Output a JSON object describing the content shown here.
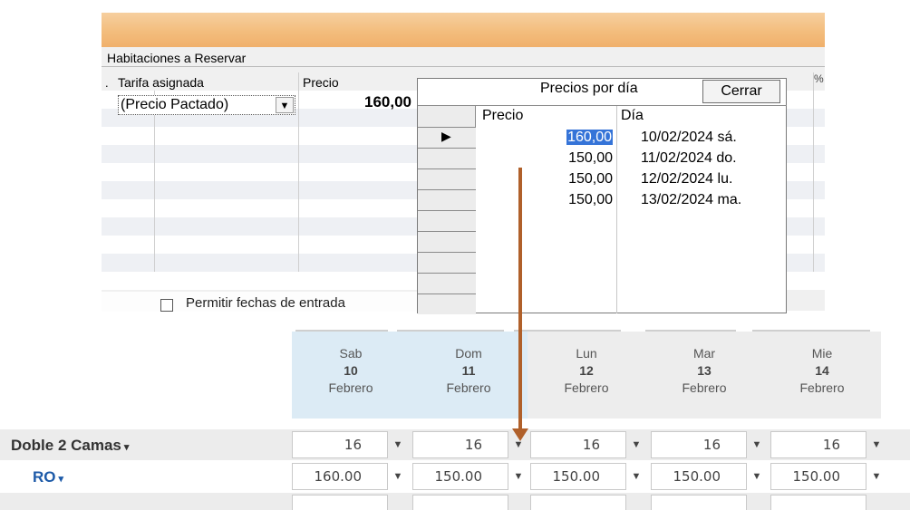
{
  "panel": {
    "title": "Habitaciones a Reservar",
    "col_dot": ".",
    "col_tarifa": "Tarifa asignada",
    "col_precio": "Precio",
    "col_pct": "%",
    "tarifa_value": "(Precio Pactado)",
    "precio_value": "160,00",
    "checkbox_label": "Permitir fechas de entrada"
  },
  "popup": {
    "title": "Precios por día",
    "close_label": "Cerrar",
    "col_precio": "Precio",
    "col_dia": "Día",
    "rows": [
      {
        "precio": "160,00",
        "dia": "10/02/2024 sá."
      },
      {
        "precio": "150,00",
        "dia": "11/02/2024 do."
      },
      {
        "precio": "150,00",
        "dia": "12/02/2024 lu."
      },
      {
        "precio": "150,00",
        "dia": "13/02/2024 ma."
      }
    ]
  },
  "calendar": {
    "days": [
      {
        "name": "Sab",
        "num": "10",
        "month": "Febrero"
      },
      {
        "name": "Dom",
        "num": "11",
        "month": "Febrero"
      },
      {
        "name": "Lun",
        "num": "12",
        "month": "Febrero"
      },
      {
        "name": "Mar",
        "num": "13",
        "month": "Febrero"
      },
      {
        "name": "Mie",
        "num": "14",
        "month": "Febrero"
      }
    ],
    "room_label": "Doble 2 Camas",
    "plan_label": "RO",
    "availability": [
      "16",
      "16",
      "16",
      "16",
      "16"
    ],
    "prices": [
      "160.00",
      "150.00",
      "150.00",
      "150.00",
      "150.00"
    ]
  },
  "colors": {
    "accent_orange": "#f3bd7d",
    "selection_blue": "#3574d8",
    "plan_blue": "#1d5aa8",
    "arrow": "#b0602a"
  },
  "icons": {
    "dropdown": "▼",
    "caret": "▾",
    "row_pointer": "▶"
  }
}
